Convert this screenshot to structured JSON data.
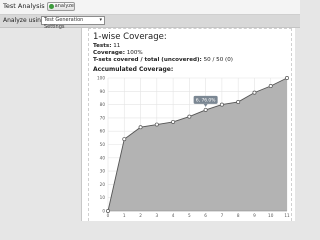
{
  "app": {
    "title": "Test Analysis",
    "analyze_label": "analyze"
  },
  "toolbar": {
    "label": "Analyze using:",
    "select_value": "Test Generation Settings"
  },
  "coverage": {
    "title": "1-wise Coverage:",
    "tests_label": "Tests:",
    "tests_value": "11",
    "coverage_label": "Coverage:",
    "coverage_value": "100%",
    "tsets_label": "T-sets covered / total (uncovered):",
    "tsets_value": "50 / 50 (0)",
    "accumulated_title": "Accumulated Coverage:"
  },
  "chart_data": {
    "type": "area",
    "x": [
      0,
      1,
      2,
      3,
      4,
      5,
      6,
      7,
      8,
      9,
      10,
      11
    ],
    "values": [
      0,
      54,
      63,
      65,
      67,
      71,
      76,
      80,
      82,
      89,
      94,
      100
    ],
    "xlim": [
      0,
      11
    ],
    "ylim": [
      0,
      100
    ],
    "yticks": [
      0,
      10,
      20,
      30,
      40,
      50,
      60,
      70,
      80,
      90,
      100
    ],
    "xticks": [
      0,
      1,
      2,
      3,
      4,
      5,
      6,
      7,
      8,
      9,
      10,
      11
    ],
    "grid": true,
    "tooltip": {
      "index": 6,
      "text": "6, 76.0%"
    },
    "colors": {
      "fill": "#b3b3b3",
      "line": "#555555",
      "point": "#ffffff",
      "tooltip_bg": "#7b8793"
    }
  }
}
